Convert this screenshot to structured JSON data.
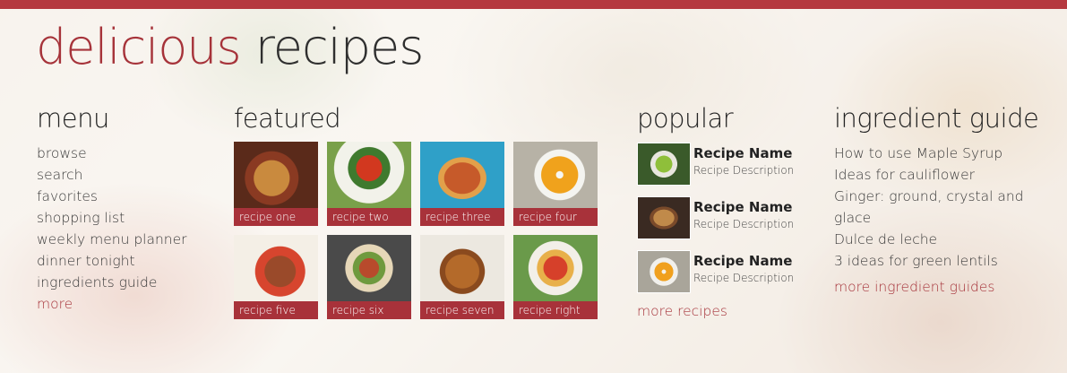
{
  "app": {
    "title_part1": "delicious",
    "title_part2": "recipes",
    "accent_color": "#b5383f"
  },
  "menu": {
    "heading": "menu",
    "items": [
      "browse",
      "search",
      "favorites",
      "shopping list",
      "weekly menu planner",
      "dinner tonight",
      "ingredients guide"
    ],
    "more": "more"
  },
  "featured": {
    "heading": "featured",
    "tiles": [
      {
        "label": "recipe one",
        "icon": "tart-image"
      },
      {
        "label": "recipe two",
        "icon": "tomato-salad-image"
      },
      {
        "label": "recipe three",
        "icon": "lasagna-image"
      },
      {
        "label": "recipe four",
        "icon": "pumpkin-soup-image"
      },
      {
        "label": "recipe five",
        "icon": "stew-pot-image"
      },
      {
        "label": "recipe six",
        "icon": "vegetable-pan-image"
      },
      {
        "label": "recipe seven",
        "icon": "curry-bowl-image"
      },
      {
        "label": "recipe right",
        "icon": "gnocchi-image"
      }
    ]
  },
  "popular": {
    "heading": "popular",
    "items": [
      {
        "name": "Recipe Name",
        "description": "Recipe Description",
        "icon": "sprouts-image"
      },
      {
        "name": "Recipe Name",
        "description": "Recipe Description",
        "icon": "pancakes-image"
      },
      {
        "name": "Recipe Name",
        "description": "Recipe Description",
        "icon": "soup-image"
      }
    ],
    "more": "more recipes"
  },
  "guide": {
    "heading": "ingredient guide",
    "items": [
      "How to use Maple Syrup",
      "Ideas for cauliflower",
      "Ginger: ground, crystal and glace",
      "Dulce de leche",
      "3 ideas for green lentils"
    ],
    "more": "more ingredient guides"
  }
}
